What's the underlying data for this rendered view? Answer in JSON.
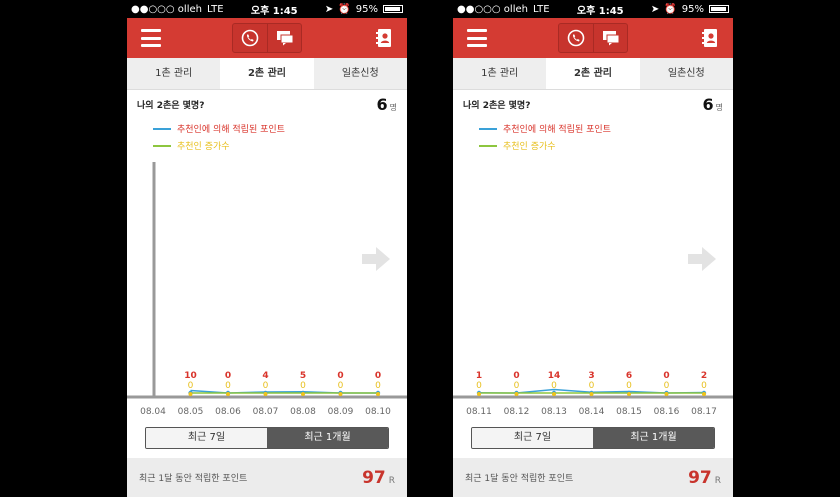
{
  "colors": {
    "accent": "#d43b33",
    "points_line": "#3aa1d8",
    "growth_line": "#8dc63f",
    "points_text": "#d9342b",
    "growth_text": "#e8c020"
  },
  "screens": [
    {
      "status": {
        "carrier": "●●○○○ olleh",
        "network": "LTE",
        "time": "오후 1:45",
        "battery": "95%"
      },
      "tabs": [
        {
          "label": "1촌 관리"
        },
        {
          "label": "2촌 관리",
          "active": true
        },
        {
          "label": "일촌신청"
        }
      ],
      "summary": {
        "question": "나의 2촌은 몇명?",
        "count": "6",
        "unit": "명"
      },
      "legend": [
        {
          "label": "추천인에 의해 적립된 포인트",
          "color": "#3aa1d8"
        },
        {
          "label": "추천인 증가수",
          "color": "#8dc63f"
        }
      ],
      "chart_data": {
        "type": "line",
        "x": [
          "08.04",
          "08.05",
          "08.06",
          "08.07",
          "08.08",
          "08.09",
          "08.10"
        ],
        "series": [
          {
            "name": "추천인에 의해 적립된 포인트",
            "values": [
              null,
              10,
              0,
              4,
              5,
              0,
              0
            ]
          },
          {
            "name": "추천인 증가수",
            "values": [
              null,
              0,
              0,
              0,
              0,
              0,
              0
            ]
          }
        ]
      },
      "range": {
        "week": "최근 7일",
        "month": "최근 1개월",
        "selected": "month"
      },
      "footer": {
        "label": "최근 1달 동안 적립한 포인트",
        "value": "97",
        "unit": "R"
      }
    },
    {
      "status": {
        "carrier": "●●○○○ olleh",
        "network": "LTE",
        "time": "오후 1:45",
        "battery": "95%"
      },
      "tabs": [
        {
          "label": "1촌 관리"
        },
        {
          "label": "2촌 관리",
          "active": true
        },
        {
          "label": "일촌신청"
        }
      ],
      "summary": {
        "question": "나의 2촌은 몇명?",
        "count": "6",
        "unit": "명"
      },
      "legend": [
        {
          "label": "추천인에 의해 적립된 포인트",
          "color": "#3aa1d8"
        },
        {
          "label": "추천인 증가수",
          "color": "#8dc63f"
        }
      ],
      "chart_data": {
        "type": "line",
        "x": [
          "08.11",
          "08.12",
          "08.13",
          "08.14",
          "08.15",
          "08.16",
          "08.17"
        ],
        "series": [
          {
            "name": "추천인에 의해 적립된 포인트",
            "values": [
              1,
              0,
              14,
              3,
              6,
              0,
              2
            ]
          },
          {
            "name": "추천인 증가수",
            "values": [
              0,
              0,
              0,
              0,
              0,
              0,
              0
            ]
          }
        ]
      },
      "range": {
        "week": "최근 7일",
        "month": "최근 1개월",
        "selected": "month"
      },
      "footer": {
        "label": "최근 1달 동안 적립한 포인트",
        "value": "97",
        "unit": "R"
      }
    }
  ]
}
